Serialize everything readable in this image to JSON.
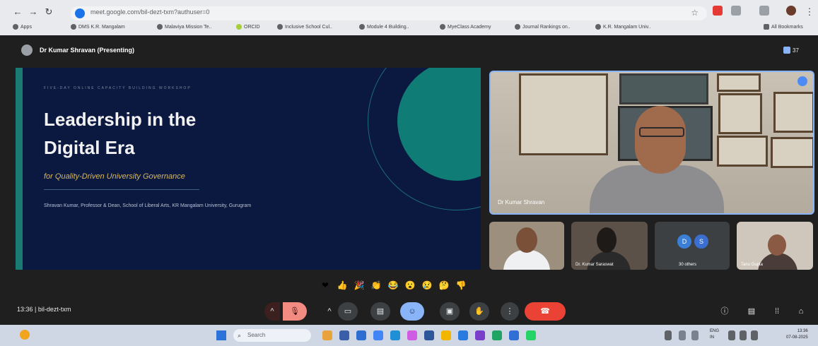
{
  "browser": {
    "url": "meet.google.com/bil-dezt-txm?authuser=0",
    "bookmarks": [
      "Apps",
      "DMS K.R. Mangalam",
      "Malaviya Mission Te..",
      "ORCID",
      "Inclusive School Cul..",
      "Module 4 Building..",
      "MyeClass Academy",
      "Journal Rankings on..",
      "K.R. Mangalam Univ.."
    ],
    "all_bookmarks": "All Bookmarks"
  },
  "meet": {
    "presenter_label": "Dr Kumar Shravan (Presenting)",
    "participant_count": "37",
    "meeting_time": "13:36",
    "meeting_code": "bil-dezt-txm",
    "speaker_name": "Dr Kumar Shravan",
    "thumbnails": [
      {
        "label": ""
      },
      {
        "label": "Dr. Kumar Saraswat"
      },
      {
        "label": "30 others",
        "avatars": [
          "D",
          "S"
        ]
      },
      {
        "label": "Tanu Gupta"
      }
    ],
    "reactions": [
      "❤",
      "👍",
      "🎉",
      "👏",
      "😂",
      "😮",
      "😢",
      "🤔",
      "👎"
    ],
    "controls": {
      "mic_more": "^",
      "mic": "🎙",
      "cam_more": "^",
      "cam": "▭",
      "captions": "▤",
      "present": "☺",
      "emoji": "▣",
      "hand": "✋",
      "more": "⋮",
      "leave": "☎"
    },
    "right_controls": [
      "ⓘ",
      "▤",
      "⁞⁞",
      "⌂"
    ]
  },
  "slide": {
    "kicker": "FIVE-DAY ONLINE CAPACITY BUILDING WORKSHOP",
    "title_line1": "Leadership in the",
    "title_line2": "Digital Era",
    "subtitle": "for Quality-Driven University Governance",
    "byline": "Shravan Kumar, Professor & Dean, School of Liberal Arts, KR Mangalam University, Gurugram"
  },
  "taskbar": {
    "search_label": "Search",
    "lang": "ENG",
    "lang_sub": "IN",
    "time": "13:36",
    "date": "07-08-2025"
  },
  "colors": {
    "slide_bg": "#0b1840",
    "slide_accent": "#0f7d75",
    "leave_button": "#ea4335",
    "present_button": "#8ab4f8"
  }
}
